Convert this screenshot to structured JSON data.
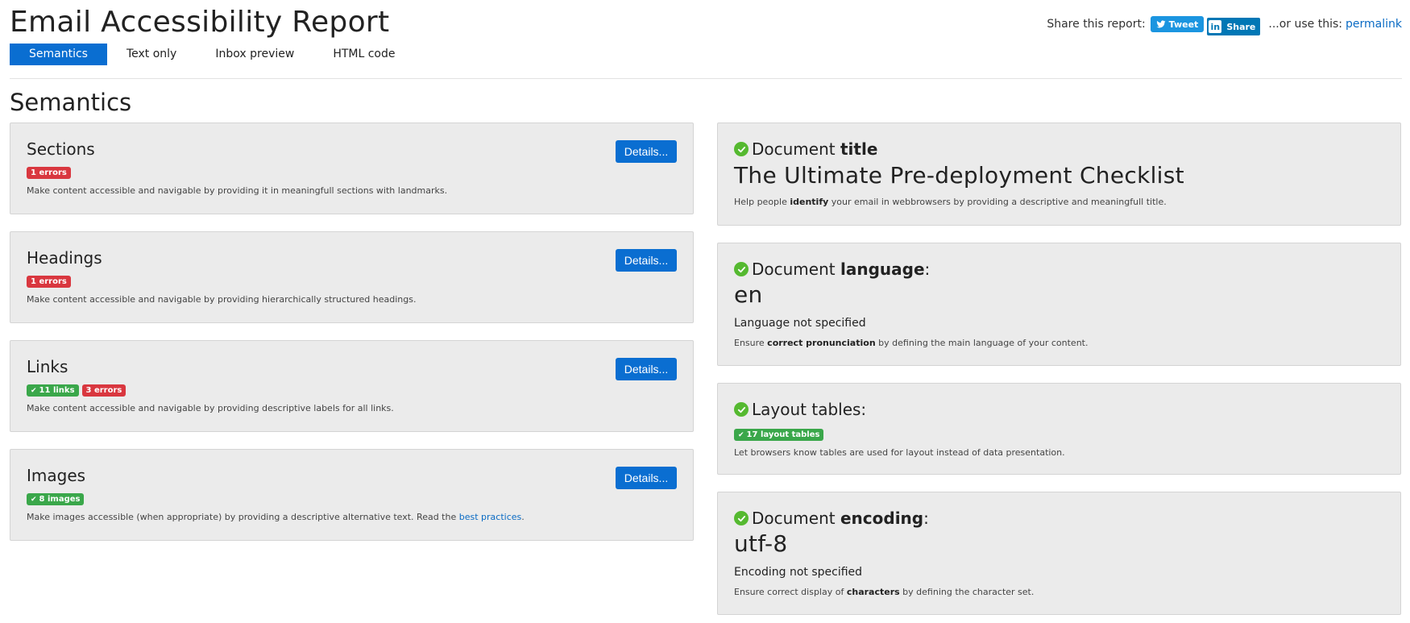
{
  "header": {
    "title": "Email Accessibility Report",
    "share_label": "Share this report:",
    "tweet_label": "Tweet",
    "linkedin_label": "Share",
    "linkedin_logo": "in",
    "or_use": "...or use this:",
    "permalink": "permalink"
  },
  "tabs": [
    {
      "label": "Semantics",
      "active": true
    },
    {
      "label": "Text only",
      "active": false
    },
    {
      "label": "Inbox preview",
      "active": false
    },
    {
      "label": "HTML code",
      "active": false
    }
  ],
  "section_title": "Semantics",
  "details_label": "Details...",
  "left_cards": [
    {
      "title": "Sections",
      "badges": [
        {
          "text": "1 errors",
          "type": "error"
        }
      ],
      "desc": "Make content accessible and navigable by providing it in meaningfull sections with landmarks."
    },
    {
      "title": "Headings",
      "badges": [
        {
          "text": "1 errors",
          "type": "error"
        }
      ],
      "desc": "Make content accessible and navigable by providing hierarchically structured headings."
    },
    {
      "title": "Links",
      "badges": [
        {
          "text": "11 links",
          "type": "ok"
        },
        {
          "text": "3 errors",
          "type": "error"
        }
      ],
      "desc": "Make content accessible and navigable by providing descriptive labels for all links."
    },
    {
      "title": "Images",
      "badges": [
        {
          "text": "8 images",
          "type": "ok"
        }
      ],
      "desc_before": "Make images accessible (when appropriate) by providing a descriptive alternative text. Read the ",
      "desc_link": "best practices",
      "desc_after": "."
    }
  ],
  "right_cards": {
    "title_card": {
      "prefix": "Document ",
      "bold": "title",
      "value": "The Ultimate Pre-deployment Checklist",
      "d1": "Help people ",
      "d_bold": "identify",
      "d2": " your email in webbrowsers by providing a descriptive and meaningfull title."
    },
    "language_card": {
      "prefix": "Document ",
      "bold": "language",
      "suffix": ":",
      "value": "en",
      "note": "Language not specified",
      "d1": "Ensure ",
      "d_bold": "correct pronunciation",
      "d2": " by defining the main language of your content."
    },
    "layout_card": {
      "title": "Layout tables:",
      "badge": "17 layout tables",
      "desc": "Let browsers know tables are used for layout instead of data presentation."
    },
    "encoding_card": {
      "prefix": "Document ",
      "bold": "encoding",
      "suffix": ":",
      "value": "utf-8",
      "note": "Encoding not specified",
      "d1": "Ensure correct display of ",
      "d_bold": "characters",
      "d2": " by defining the character set."
    }
  },
  "colors": {
    "accent": "#0a6ed1",
    "error": "#d9373f",
    "success": "#3aa74a",
    "check": "#55b930",
    "card_bg": "#ebebeb"
  }
}
